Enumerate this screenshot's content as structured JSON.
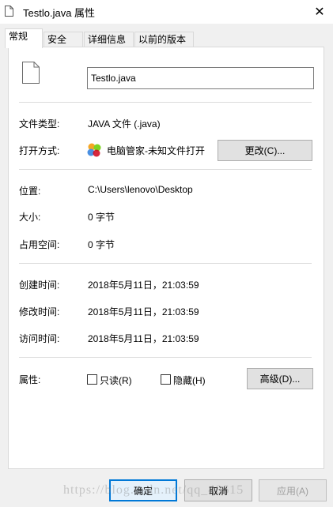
{
  "window": {
    "title": "Testlo.java 属性",
    "close_glyph": "✕"
  },
  "tabs": [
    {
      "label": "常规",
      "active": true
    },
    {
      "label": "安全",
      "active": false
    },
    {
      "label": "详细信息",
      "active": false
    },
    {
      "label": "以前的版本",
      "active": false
    }
  ],
  "file": {
    "name": "Testlo.java"
  },
  "rows": {
    "type_label": "文件类型:",
    "type_value": "JAVA 文件 (.java)",
    "open_label": "打开方式:",
    "open_value": "电脑管家-未知文件打开",
    "change_button": "更改(C)...",
    "location_label": "位置:",
    "location_value": "C:\\Users\\lenovo\\Desktop",
    "size_label": "大小:",
    "size_value": "0 字节",
    "disk_label": "占用空间:",
    "disk_value": "0 字节",
    "created_label": "创建时间:",
    "created_value": "2018年5月11日，21:03:59",
    "modified_label": "修改时间:",
    "modified_value": "2018年5月11日，21:03:59",
    "accessed_label": "访问时间:",
    "accessed_value": "2018年5月11日，21:03:59",
    "attr_label": "属性:",
    "readonly_label": "只读(R)",
    "hidden_label": "隐藏(H)",
    "advanced_button": "高级(D)..."
  },
  "footer": {
    "ok": "确定",
    "cancel": "取消",
    "apply": "应用(A)"
  },
  "watermark": "https://blog.csdn.net/qq_40615"
}
